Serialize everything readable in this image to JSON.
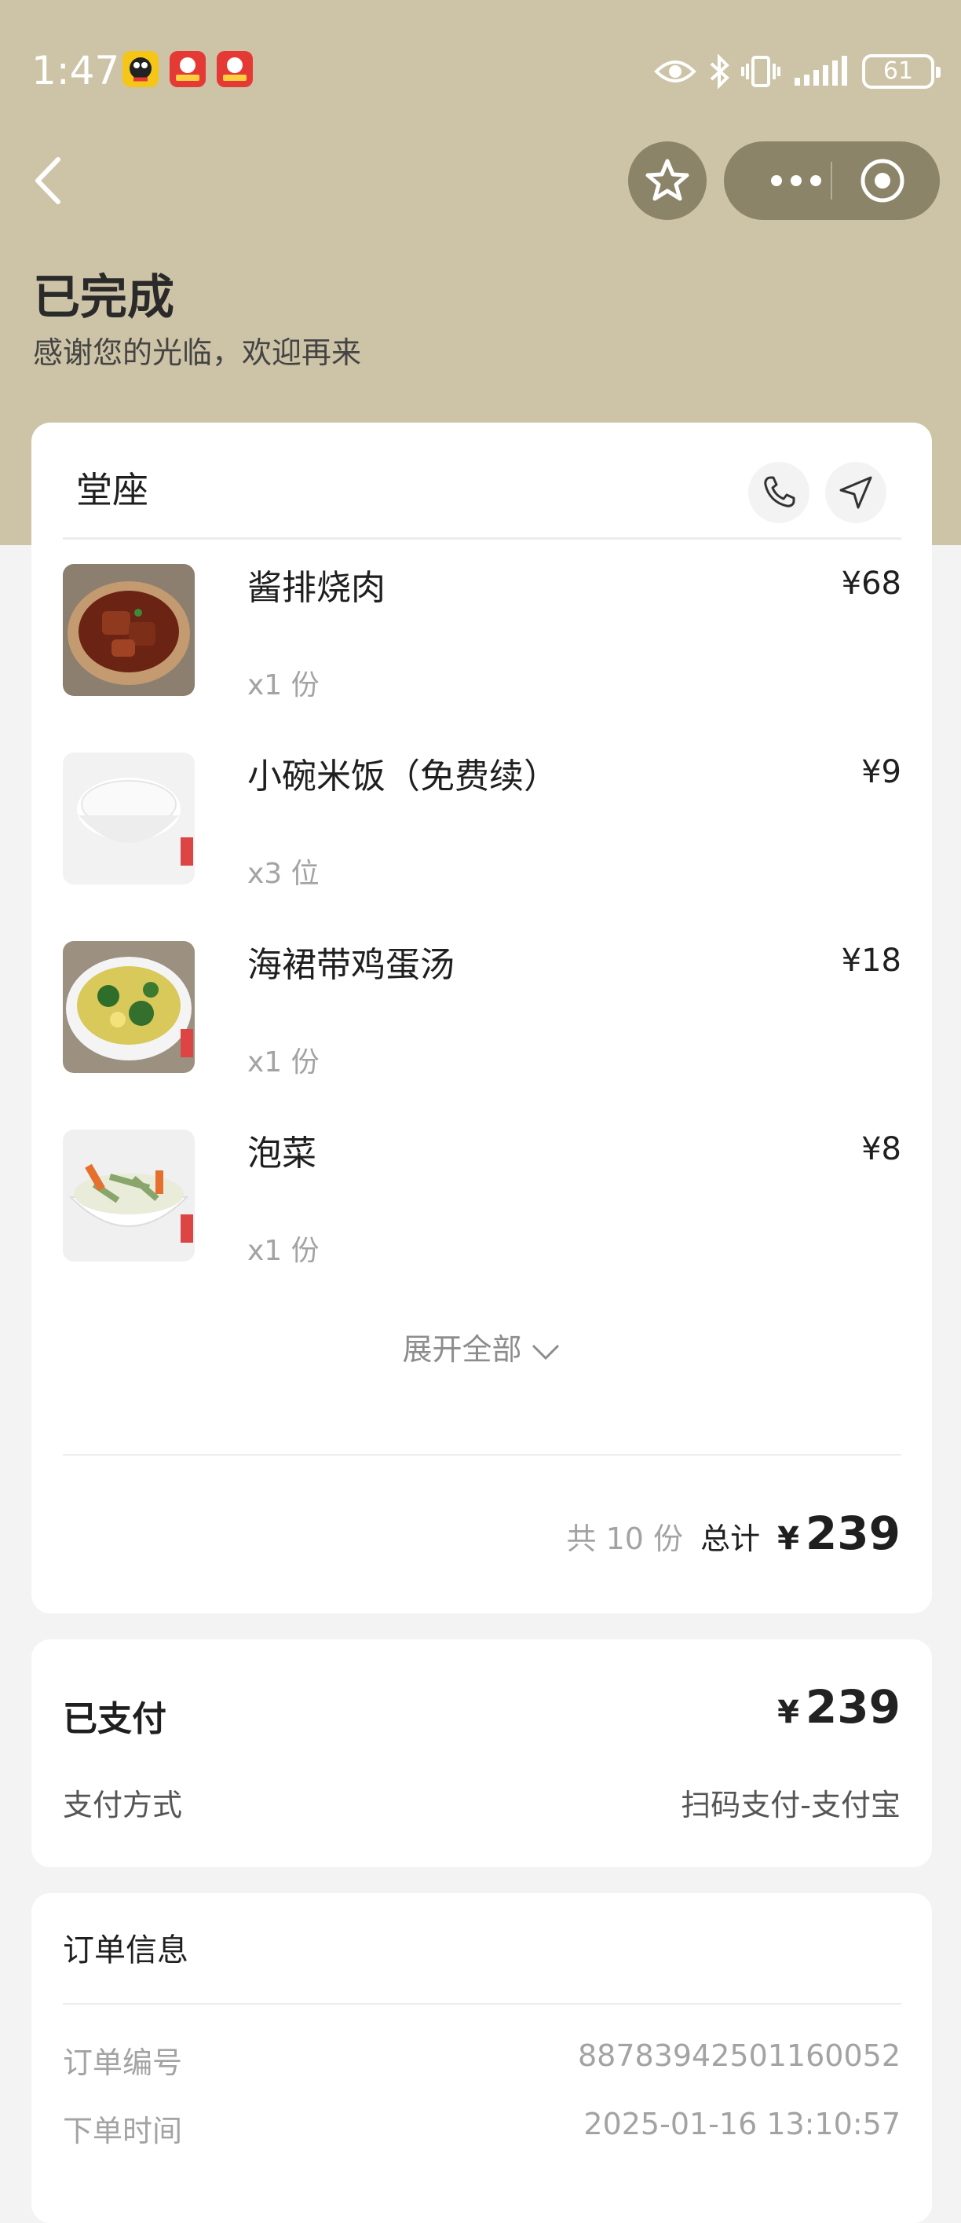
{
  "status_bar": {
    "time": "1:47",
    "battery": "61",
    "notification_icons": [
      "penguin-app-icon",
      "meituan-app-icon",
      "meituan-app-icon"
    ],
    "system_icons": [
      "eye-icon",
      "bluetooth-icon",
      "vibrate-icon",
      "signal-icon",
      "battery-icon"
    ]
  },
  "header": {
    "title": "已完成",
    "subtitle": "感谢您的光临，欢迎再来",
    "background": "#cdc3a6",
    "button_color": "#8b8468"
  },
  "order": {
    "dine_type": "堂座",
    "items": [
      {
        "name": "酱排烧肉",
        "price": "¥68",
        "qty": "x1 份",
        "image": "braised-pork-photo"
      },
      {
        "name": "小碗米饭（免费续）",
        "price": "¥9",
        "qty": "x3 位",
        "image": "rice-bowl-photo"
      },
      {
        "name": "海裙带鸡蛋汤",
        "price": "¥18",
        "qty": "x1 份",
        "image": "seaweed-egg-soup-photo"
      },
      {
        "name": "泡菜",
        "price": "¥8",
        "qty": "x1 份",
        "image": "pickled-vegetables-photo"
      }
    ],
    "expand_label": "展开全部",
    "count_text": "共 10 份",
    "total_label": "总计",
    "currency": "¥",
    "total": "239"
  },
  "payment": {
    "paid_label": "已支付",
    "currency": "¥",
    "amount": "239",
    "method_label": "支付方式",
    "method_value": "扫码支付-支付宝"
  },
  "order_info": {
    "title": "订单信息",
    "rows": [
      {
        "label": "订单编号",
        "value": "88783942501160052"
      },
      {
        "label": "下单时间",
        "value": "2025-01-16 13:10:57"
      }
    ]
  }
}
